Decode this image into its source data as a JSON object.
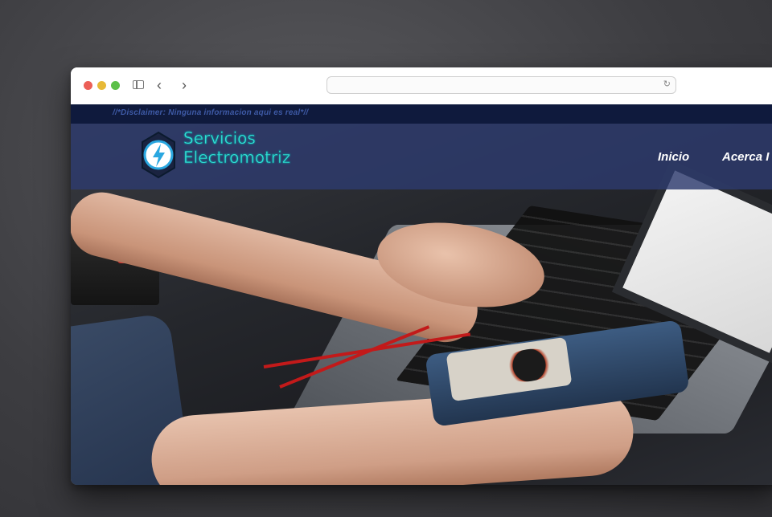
{
  "browser": {
    "url": ""
  },
  "site": {
    "disclaimer": "//*Disclaimer: Ninguna informacion aqui es real*//",
    "logo_line1": "Servicios",
    "logo_line2": "Electromotriz",
    "nav": {
      "inicio": "Inicio",
      "acerca": "Acerca I"
    },
    "colors": {
      "accent": "#33e0d6",
      "navbar": "#2d3a6e",
      "disclaimer_bar": "#0f1a3d"
    }
  },
  "icons": [
    "sidebar-icon",
    "back-icon",
    "forward-icon",
    "reload-icon",
    "lightning-bolt-icon"
  ]
}
